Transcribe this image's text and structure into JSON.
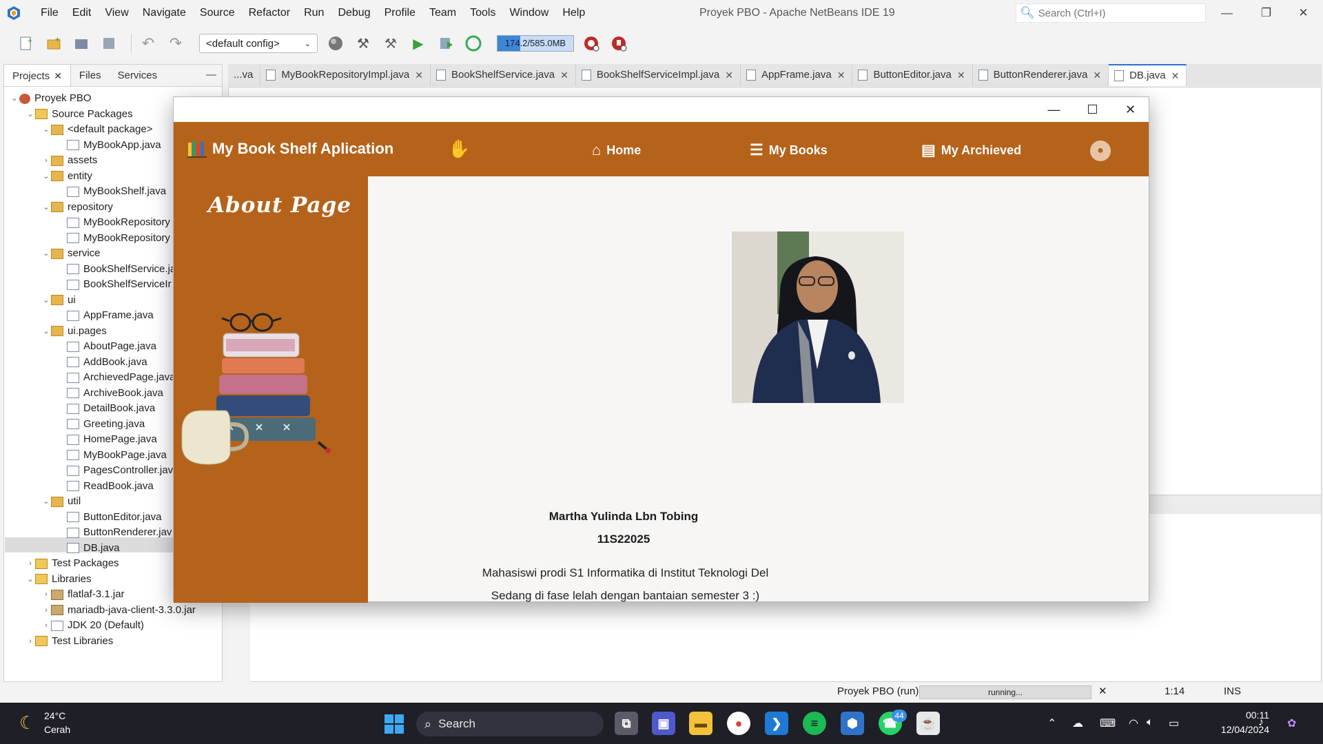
{
  "ide": {
    "menu": [
      "File",
      "Edit",
      "View",
      "Navigate",
      "Source",
      "Refactor",
      "Run",
      "Debug",
      "Profile",
      "Team",
      "Tools",
      "Window",
      "Help"
    ],
    "window_title": "Proyek PBO - Apache NetBeans IDE 19",
    "search_placeholder": "Search (Ctrl+I)",
    "config": "<default config>",
    "memory": "174.2/585.0MB"
  },
  "projects_panel": {
    "tabs": [
      "Projects",
      "Files",
      "Services"
    ],
    "tree": [
      {
        "label": "Proyek PBO",
        "icon": "project-icon",
        "level": 0,
        "expanded": true
      },
      {
        "label": "Source Packages",
        "icon": "folder-icon",
        "level": 1,
        "expanded": true
      },
      {
        "label": "<default package>",
        "icon": "package-icon",
        "level": 2,
        "expanded": true
      },
      {
        "label": "MyBookApp.java",
        "icon": "java-file-icon",
        "level": 3
      },
      {
        "label": "assets",
        "icon": "package-icon",
        "level": 2,
        "expanded": false
      },
      {
        "label": "entity",
        "icon": "package-icon",
        "level": 2,
        "expanded": true
      },
      {
        "label": "MyBookShelf.java",
        "icon": "java-file-icon",
        "level": 3
      },
      {
        "label": "repository",
        "icon": "package-icon",
        "level": 2,
        "expanded": true
      },
      {
        "label": "MyBookRepository",
        "icon": "java-file-icon",
        "level": 3
      },
      {
        "label": "MyBookRepository",
        "icon": "java-file-icon",
        "level": 3
      },
      {
        "label": "service",
        "icon": "package-icon",
        "level": 2,
        "expanded": true
      },
      {
        "label": "BookShelfService.ja",
        "icon": "java-file-icon",
        "level": 3
      },
      {
        "label": "BookShelfServiceIr",
        "icon": "java-file-icon",
        "level": 3
      },
      {
        "label": "ui",
        "icon": "package-icon",
        "level": 2,
        "expanded": true
      },
      {
        "label": "AppFrame.java",
        "icon": "java-file-icon",
        "level": 3
      },
      {
        "label": "ui.pages",
        "icon": "package-icon",
        "level": 2,
        "expanded": true
      },
      {
        "label": "AboutPage.java",
        "icon": "java-file-icon",
        "level": 3
      },
      {
        "label": "AddBook.java",
        "icon": "java-file-icon",
        "level": 3
      },
      {
        "label": "ArchievedPage.java",
        "icon": "java-file-icon",
        "level": 3
      },
      {
        "label": "ArchiveBook.java",
        "icon": "java-file-icon",
        "level": 3
      },
      {
        "label": "DetailBook.java",
        "icon": "java-file-icon",
        "level": 3
      },
      {
        "label": "Greeting.java",
        "icon": "java-file-icon",
        "level": 3
      },
      {
        "label": "HomePage.java",
        "icon": "java-file-icon",
        "level": 3
      },
      {
        "label": "MyBookPage.java",
        "icon": "java-file-icon",
        "level": 3
      },
      {
        "label": "PagesController.jav",
        "icon": "java-file-icon",
        "level": 3
      },
      {
        "label": "ReadBook.java",
        "icon": "java-file-icon",
        "level": 3
      },
      {
        "label": "util",
        "icon": "package-icon",
        "level": 2,
        "expanded": true
      },
      {
        "label": "ButtonEditor.java",
        "icon": "java-file-icon",
        "level": 3
      },
      {
        "label": "ButtonRenderer.jav",
        "icon": "java-file-icon",
        "level": 3
      },
      {
        "label": "DB.java",
        "icon": "java-file-icon",
        "level": 3,
        "selected": true
      },
      {
        "label": "Test Packages",
        "icon": "folder-icon",
        "level": 1,
        "expanded": false
      },
      {
        "label": "Libraries",
        "icon": "folder-icon",
        "level": 1,
        "expanded": true
      },
      {
        "label": "flatlaf-3.1.jar",
        "icon": "jar-icon",
        "level": 2,
        "expanded": false
      },
      {
        "label": "mariadb-java-client-3.3.0.jar",
        "icon": "jar-icon",
        "level": 2,
        "expanded": false
      },
      {
        "label": "JDK 20 (Default)",
        "icon": "jdk-icon",
        "level": 2,
        "expanded": false
      },
      {
        "label": "Test Libraries",
        "icon": "folder-icon",
        "level": 1,
        "expanded": false
      }
    ]
  },
  "editor_tabs": [
    {
      "label": "...va",
      "active": false
    },
    {
      "label": "MyBookRepositoryImpl.java",
      "active": false
    },
    {
      "label": "BookShelfService.java",
      "active": false
    },
    {
      "label": "BookShelfServiceImpl.java",
      "active": false
    },
    {
      "label": "AppFrame.java",
      "active": false
    },
    {
      "label": "ButtonEditor.java",
      "active": false
    },
    {
      "label": "ButtonRenderer.java",
      "active": false
    },
    {
      "label": "DB.java",
      "active": true
    }
  ],
  "statusbar": {
    "project": "Proyek PBO (run)",
    "progress": "running...",
    "position": "1:14",
    "mode": "INS"
  },
  "taskbar": {
    "temperature": "24°C",
    "condition": "Cerah",
    "search": "Search",
    "whatsapp_badge": "44",
    "time": "00:11",
    "date": "12/04/2024"
  },
  "app": {
    "brand": "My Book Shelf Aplication",
    "nav": {
      "home": "Home",
      "my_books": "My Books",
      "my_archieved": "My Archieved"
    },
    "sidebar_title": "About Page",
    "profile": {
      "name": "Martha Yulinda Lbn Tobing",
      "nim": "11S22025",
      "desc_line1": "Mahasiswi prodi S1 Informatika di Institut Teknologi Del",
      "desc_line2": "Sedang di fase lelah dengan bantaian semester 3 :)"
    }
  }
}
